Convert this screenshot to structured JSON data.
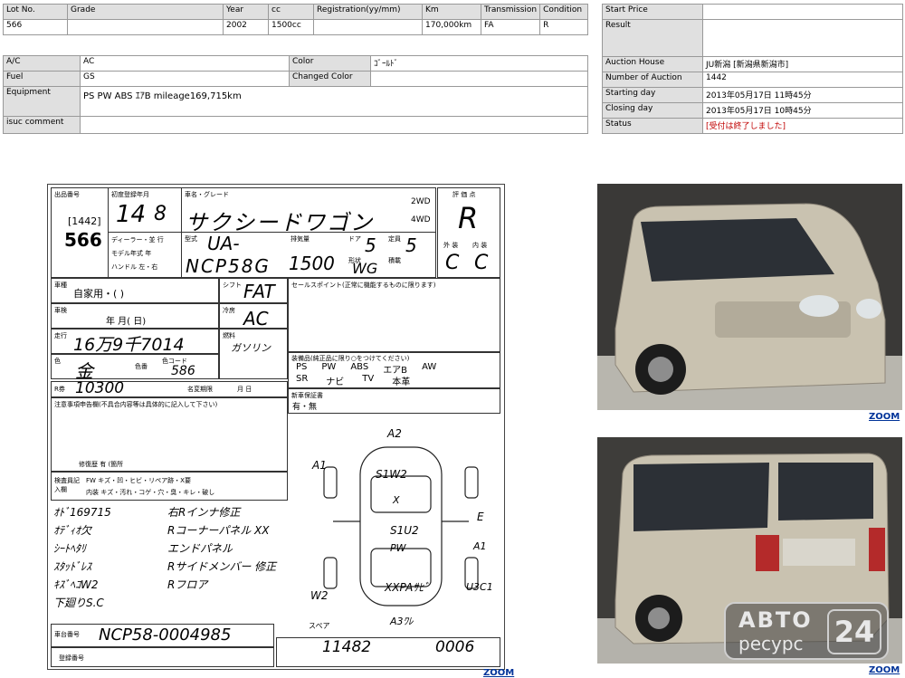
{
  "lot_table": {
    "headers": [
      "Lot No.",
      "Grade",
      "Year",
      "cc",
      "Registration(yy/mm)",
      "Km",
      "Transmission",
      "Condition"
    ],
    "values": [
      "566",
      "",
      "2002",
      "1500cc",
      "",
      "170,000km",
      "FA",
      "R"
    ]
  },
  "specs": {
    "ac_label": "A/C",
    "ac_value": "AC",
    "color_label": "Color",
    "color_value": "ｺﾞｰﾙﾄﾞ",
    "fuel_label": "Fuel",
    "fuel_value": "GS",
    "changed_color_label": "Changed Color",
    "changed_color_value": "",
    "equipment_label": "Equipment",
    "equipment_value": "PS PW ABS ｴｱB  mileage169,715km",
    "comment_label": "isuc comment",
    "comment_value": ""
  },
  "auction": {
    "start_price_label": "Start Price",
    "start_price_value": "",
    "result_label": "Result",
    "result_value": "",
    "house_label": "Auction House",
    "house_value": "JU新潟 [新潟県新潟市]",
    "number_label": "Number of Auction",
    "number_value": "1442",
    "starting_label": "Starting day",
    "starting_value": "2013年05月17日 11時45分",
    "closing_label": "Closing day",
    "closing_value": "2013年05月17日 10時45分",
    "status_label": "Status",
    "status_value": "[受付は終了しました]"
  },
  "sheet": {
    "lot_label": "出品番号",
    "auction_no": "[1442]",
    "lot_no": "566",
    "first_reg_label": "初度登録年月",
    "year_hand": "14",
    "month_hand": "8",
    "name_label": "車名・グレード",
    "name_hand": "サクシードワゴン",
    "drive_2wd": "2WD",
    "drive_4wd": "4WD",
    "grade_label": "評 価 点",
    "grade_hand": "R",
    "exterior_label": "外 装",
    "interior_label": "内 装",
    "exterior_hand": "C",
    "interior_hand": "C",
    "dealer_label": "ディーラー・並 行",
    "model_year_label": "モデル年式 年",
    "handle_label": "ハンドル 左・右",
    "type_label": "型式",
    "type_hand_1": "UA-",
    "type_hand_2": "NCP58G",
    "displacement_label": "排気量",
    "displacement_hand": "1500",
    "doors_label": "ドア",
    "doors_hand": "5",
    "capacity_label": "定員",
    "capacity_hand": "5",
    "shape_label": "形状",
    "shape_hand": "WG",
    "load_label": "積載",
    "usage_label": "車種",
    "usage_value": "自家用・(      )",
    "shift_label": "シフト",
    "shift_hand": "FAT",
    "inspection_label": "車検",
    "inspection_value": "年    月(    日)",
    "cooler_label": "冷房",
    "cooler_hand": "AC",
    "mileage_label": "走行",
    "mileage_hand": "16万9千7014",
    "fuel_label": "燃料",
    "fuel_hand": "ガソリン",
    "color_label": "色",
    "color_hand": "金",
    "color_no_label": "色番",
    "color_code_label": "色コード",
    "color_code_hand": "586",
    "sales_point_label": "セールスポイント(正常に機能するものに限ります)",
    "equip_label": "装備品(純正品に限り○をつけてください)",
    "equip_row1": [
      "PS",
      "PW",
      "ABS",
      "エアB",
      "AW"
    ],
    "equip_row2": [
      "SR",
      "ナビ",
      "TV",
      "本革"
    ],
    "recycle_label": "R券",
    "recycle_hand": "10300",
    "registration_term_label": "名変期限",
    "registration_term_value": "月    日",
    "warranty_label": "新車保証書",
    "warranty_value": "有・無",
    "notes_label": "注意事項申告欄(不具合内容等は具体的に記入して下さい)",
    "repair_label": "修復歴 有 (箇所",
    "inspector_label": "検査員記入欄",
    "check_row1": "FW キズ・凹・ヒビ・リペア跡・X要",
    "check_row2": "内装 キズ・汚れ・コゲ・穴・臭・キレ・破し",
    "notes_left": [
      "ｵﾄﾞ169715",
      "ｵﾃﾞｨｵ欠",
      "ｼｰﾄﾍﾀﾘ",
      "ｽﾀｯﾄﾞﾚｽ",
      "ｷｽﾞﾍｺW2",
      "下廻りS.C"
    ],
    "notes_right": [
      "右Rインナ修正",
      "Rコーナーパネル XX",
      "エンドパネル",
      "Rサイドメンバー 修正",
      "Rフロア"
    ],
    "chassis_label": "車台番号",
    "chassis_hand": "NCP58-0004985",
    "reg_no_label": "登録番号",
    "bottom_ref": "11482",
    "bottom_ref2": "0006",
    "diagram_marks": [
      "A2",
      "A1",
      "S1W2",
      "X",
      "S1U2",
      "PW",
      "E",
      "A1",
      "XXPAｻﾋﾞ",
      "W2",
      "U3C1",
      "A3ﾜﾚ",
      "スペア"
    ]
  },
  "zoom_label": "ZOOM",
  "watermark_top": "АВТО",
  "watermark_bottom": "ресурс",
  "watermark_num": "24"
}
